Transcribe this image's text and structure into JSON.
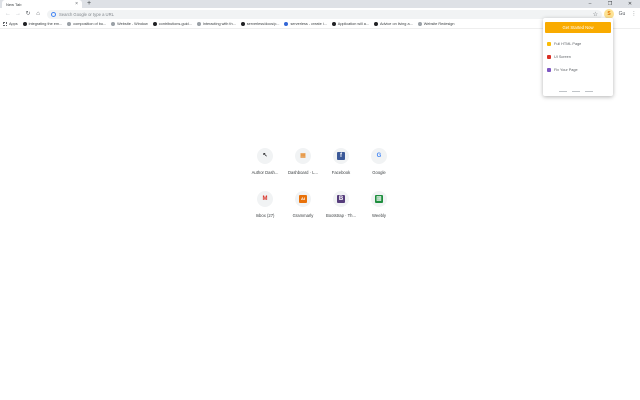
{
  "browser": {
    "tab_title": "New Tab",
    "tab_close": "×",
    "new_tab": "+",
    "window_controls": [
      "–",
      "❐",
      "✕"
    ]
  },
  "toolbar": {
    "back": "←",
    "forward": "→",
    "reload": "↻",
    "home": "⌂",
    "omnibox_placeholder": "Search Google or type a URL",
    "star": "☆",
    "ext_label": "S",
    "profile": "Gu",
    "menu": "⋮"
  },
  "bookmarks": [
    {
      "label": "Apps",
      "icon": "grid"
    },
    {
      "label": "integrating the em...",
      "icon": "github"
    },
    {
      "label": "composition of bu...",
      "icon": "doc"
    },
    {
      "label": "Website - Window",
      "icon": "wiki"
    },
    {
      "label": "contributions-guid...",
      "icon": "github"
    },
    {
      "label": "Interacting with th...",
      "icon": "grey"
    },
    {
      "label": "serverless/docs/p...",
      "icon": "github"
    },
    {
      "label": "serverless - create i...",
      "icon": "blue"
    },
    {
      "label": "Application will a...",
      "icon": "github"
    },
    {
      "label": "Advice on living a...",
      "icon": "github"
    },
    {
      "label": "Website Redesign",
      "icon": "grey"
    }
  ],
  "shortcuts": [
    {
      "label": "Author Dash...",
      "glyph": "↖",
      "color": "#202124"
    },
    {
      "label": "Dashboard · L...",
      "glyph": "▦",
      "color": "#e37400"
    },
    {
      "label": "Facebook",
      "glyph": "f",
      "color": "#3b5998"
    },
    {
      "label": "Google",
      "glyph": "G",
      "color": "#4285f4"
    },
    {
      "label": "Inbox (27)",
      "glyph": "M",
      "color": "#d93025"
    },
    {
      "label": "Grammarly",
      "glyph": "AI",
      "color": "#e8710a"
    },
    {
      "label": "Bootstrap · Th...",
      "glyph": "B",
      "color": "#563d7c"
    },
    {
      "label": "Weebly",
      "glyph": "▩",
      "color": "#1e8e3e"
    }
  ],
  "popup": {
    "cta": "Get Started Now",
    "items": [
      {
        "label": "Full HTML Page",
        "color": "#fbbc04"
      },
      {
        "label": "UI Screen",
        "color": "#d93025"
      },
      {
        "label": "Fix Your Page",
        "color": "#7e57c2"
      }
    ]
  }
}
